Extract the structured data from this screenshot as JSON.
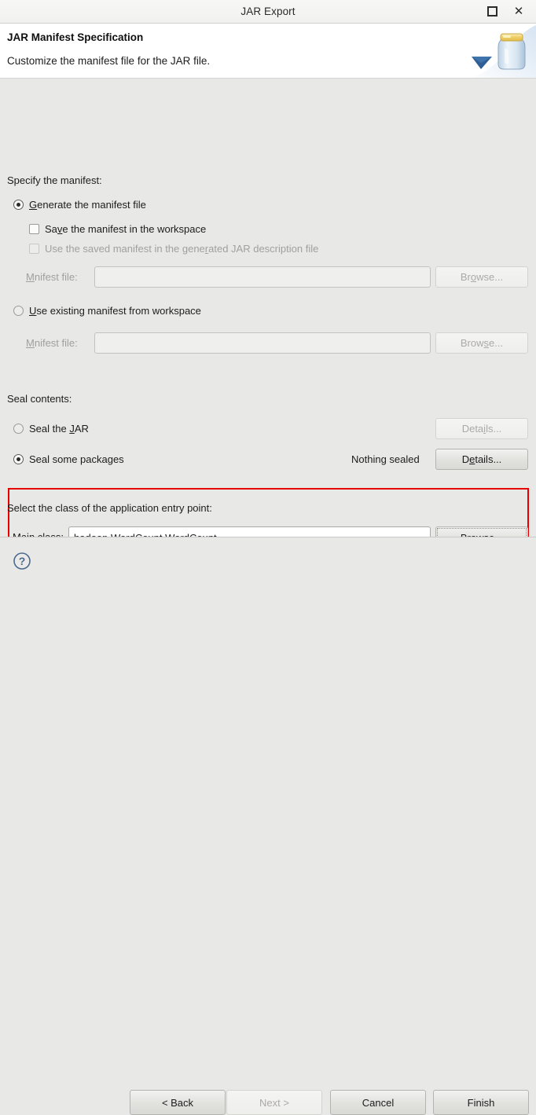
{
  "window": {
    "title": "JAR Export",
    "maximize_label": "Maximize",
    "close_label": "Close"
  },
  "banner": {
    "title": "JAR Manifest Specification",
    "subtitle": "Customize the manifest file for the JAR file.",
    "icon": "jar-file-icon"
  },
  "manifest_section": {
    "heading": "Specify the manifest:",
    "generate_radio": {
      "label_pre": "",
      "mnemonic": "G",
      "label_post": "enerate the manifest file",
      "full_label": "Generate the manifest file",
      "checked": true
    },
    "save_checkbox": {
      "label_pre": "Sa",
      "mnemonic": "v",
      "label_post": "e the manifest in the workspace",
      "full_label": "Save the manifest in the workspace",
      "checked": false,
      "enabled": true
    },
    "use_saved_checkbox": {
      "label_pre": "Use the saved manifest in the gene",
      "mnemonic": "r",
      "label_post": "ated JAR description file",
      "full_label": "Use the saved manifest in the generated JAR description file",
      "checked": false,
      "enabled": false
    },
    "manifest_file_1": {
      "label_pre": "M",
      "mnemonic": "a",
      "label_post": "nifest file:",
      "full_label": "Manifest file:",
      "value": "",
      "enabled": false,
      "browse": {
        "label_pre": "Br",
        "mnemonic": "o",
        "label_post": "wse...",
        "full_label": "Browse...",
        "enabled": false
      }
    },
    "use_existing_radio": {
      "label_pre": "",
      "mnemonic": "U",
      "label_post": "se existing manifest from workspace",
      "full_label": "Use existing manifest from workspace",
      "checked": false
    },
    "manifest_file_2": {
      "label_pre": "M",
      "mnemonic": "a",
      "label_post": "nifest file:",
      "full_label": "Manifest file:",
      "value": "",
      "enabled": false,
      "browse": {
        "label_pre": "Brow",
        "mnemonic": "s",
        "label_post": "e...",
        "full_label": "Browse...",
        "enabled": false
      }
    }
  },
  "seal_section": {
    "heading": "Seal contents:",
    "seal_jar_radio": {
      "label_pre": "Seal the ",
      "mnemonic": "J",
      "label_post": "AR",
      "full_label": "Seal the JAR",
      "checked": false
    },
    "seal_jar_details": {
      "label_pre": "Deta",
      "mnemonic": "i",
      "label_post": "ls...",
      "full_label": "Details...",
      "enabled": false
    },
    "seal_packages_radio": {
      "full_label": "Seal some packages",
      "checked": true
    },
    "sealed_status": "Nothing sealed",
    "seal_packages_details": {
      "label_pre": "D",
      "mnemonic": "e",
      "label_post": "tails...",
      "full_label": "Details...",
      "enabled": true
    }
  },
  "entry_point_section": {
    "heading": "Select the class of the application entry point:",
    "main_class_label": {
      "label_pre": "Main ",
      "mnemonic": "c",
      "label_post": "lass:",
      "full_label": "Main class:"
    },
    "main_class_value": "hadoop.WordCount.WordCount",
    "browse": {
      "label_pre": "Brow",
      "mnemonic": "s",
      "label_post": "e...",
      "full_label": "Browse...",
      "enabled": true,
      "focused": true
    },
    "highlight_color": "#e60000"
  },
  "footer": {
    "help_label": "?",
    "back": {
      "label": "< Back",
      "enabled": true
    },
    "next": {
      "label": "Next >",
      "enabled": false
    },
    "cancel": {
      "label": "Cancel",
      "enabled": true
    },
    "finish": {
      "label": "Finish",
      "enabled": true
    }
  }
}
